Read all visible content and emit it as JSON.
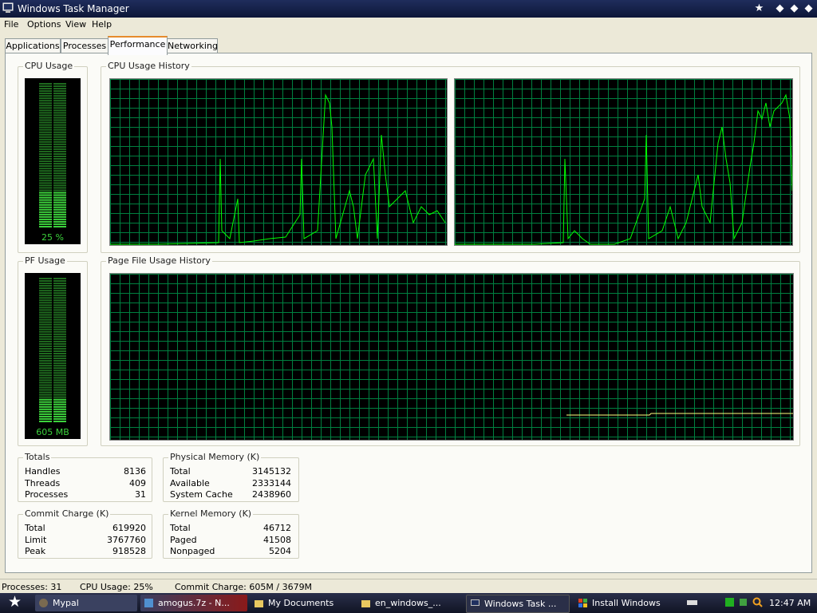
{
  "window": {
    "title": "Windows Task Manager"
  },
  "menu": [
    "File",
    "Options",
    "View",
    "Help"
  ],
  "tabs": [
    "Applications",
    "Processes",
    "Performance",
    "Networking"
  ],
  "active_tab": "Performance",
  "cpu_usage": {
    "label": "CPU Usage",
    "value_text": "25 %",
    "fraction": 0.25
  },
  "cpu_history": {
    "label": "CPU Usage History"
  },
  "pf_usage": {
    "label": "PF Usage",
    "value_text": "605 MB",
    "fraction": 0.16
  },
  "pf_history": {
    "label": "Page File Usage History"
  },
  "totals": {
    "label": "Totals",
    "rows": [
      {
        "k": "Handles",
        "v": "8136"
      },
      {
        "k": "Threads",
        "v": "409"
      },
      {
        "k": "Processes",
        "v": "31"
      }
    ]
  },
  "physical_memory": {
    "label": "Physical Memory (K)",
    "rows": [
      {
        "k": "Total",
        "v": "3145132"
      },
      {
        "k": "Available",
        "v": "2333144"
      },
      {
        "k": "System Cache",
        "v": "2438960"
      }
    ]
  },
  "commit_charge": {
    "label": "Commit Charge (K)",
    "rows": [
      {
        "k": "Total",
        "v": "619920"
      },
      {
        "k": "Limit",
        "v": "3767760"
      },
      {
        "k": "Peak",
        "v": "918528"
      }
    ]
  },
  "kernel_memory": {
    "label": "Kernel Memory (K)",
    "rows": [
      {
        "k": "Total",
        "v": "46712"
      },
      {
        "k": "Paged",
        "v": "41508"
      },
      {
        "k": "Nonpaged",
        "v": "5204"
      }
    ]
  },
  "status": {
    "processes": "Processes: 31",
    "cpu": "CPU Usage: 25%",
    "commit": "Commit Charge: 605M / 3679M"
  },
  "taskbar": {
    "items": [
      {
        "label": "Mypal",
        "icon": "browser-icon"
      },
      {
        "label": "amogus.7z - N...",
        "icon": "archive-icon"
      },
      {
        "label": "My Documents",
        "icon": "folder-icon"
      },
      {
        "label": "en_windows_...",
        "icon": "folder-icon"
      },
      {
        "label": "Windows Task ...",
        "icon": "task-manager-icon"
      },
      {
        "label": "Install Windows",
        "icon": "windows-icon"
      }
    ],
    "clock": "12:47 AM"
  },
  "colors": {
    "graph_line": "#00ff00",
    "grid": "#008040",
    "meter_on": "#3cd23c",
    "meter_off": "#1f6b1f",
    "pf_line": "#ffff80",
    "titlebar": "#0d1638"
  }
}
